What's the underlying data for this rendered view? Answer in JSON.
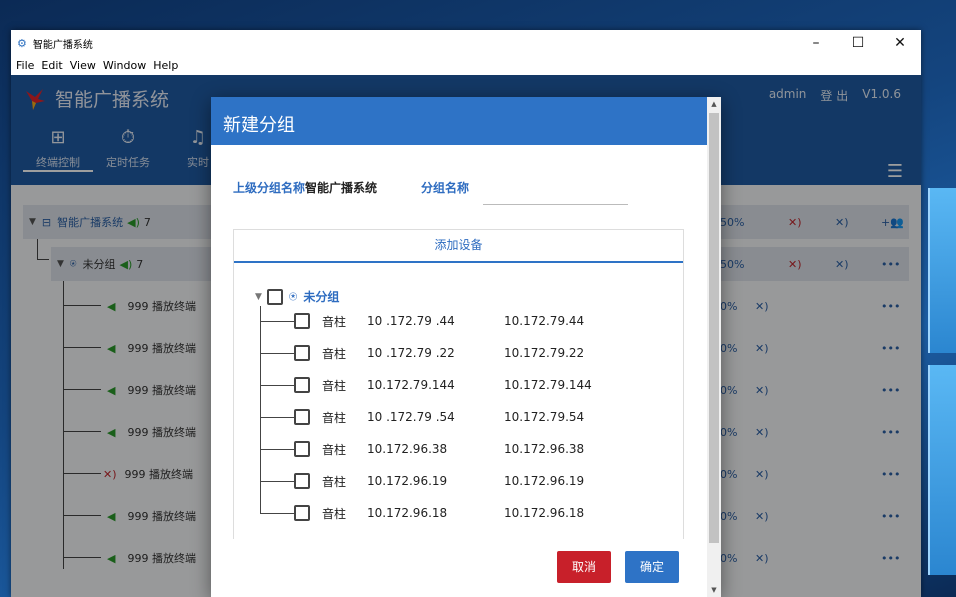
{
  "window": {
    "title": "智能广播系统"
  },
  "menu": [
    "File",
    "Edit",
    "View",
    "Window",
    "Help"
  ],
  "header": {
    "brand": "智能广播系统",
    "nav": [
      {
        "label": "终端控制",
        "icon": "terminal-icon"
      },
      {
        "label": "定时任务",
        "icon": "timer-icon"
      },
      {
        "label": "实时",
        "icon": "music-icon"
      }
    ],
    "user": "admin",
    "logout": "登 出",
    "version": "V1.0.6"
  },
  "tree": {
    "root": {
      "name": "智能广播系统",
      "count": "7",
      "percent": "50%"
    },
    "group": {
      "name": "未分组",
      "count": "7",
      "percent": "50%"
    },
    "terminals": [
      {
        "label": "999 播放终端",
        "muted": false,
        "percent": "0%"
      },
      {
        "label": "999 播放终端",
        "muted": false,
        "percent": "0%"
      },
      {
        "label": "999 播放终端",
        "muted": false,
        "percent": "0%"
      },
      {
        "label": "999 播放终端",
        "muted": false,
        "percent": "0%"
      },
      {
        "label": "999 播放终端",
        "muted": true,
        "percent": "0%"
      },
      {
        "label": "999 播放终端",
        "muted": false,
        "percent": "0%"
      },
      {
        "label": "999 播放终端",
        "muted": false,
        "percent": "0%"
      }
    ]
  },
  "dialog": {
    "title": "新建分组",
    "parent_label": "上级分组名称",
    "parent_value": "智能广播系统",
    "name_label": "分组名称",
    "name_value": "",
    "tab": "添加设备",
    "group_name": "未分组",
    "devices": [
      {
        "type": "音柱",
        "ip_display": "10 .172.79 .44",
        "ip": "10.172.79.44"
      },
      {
        "type": "音柱",
        "ip_display": "10 .172.79 .22",
        "ip": "10.172.79.22"
      },
      {
        "type": "音柱",
        "ip_display": "10.172.79.144",
        "ip": "10.172.79.144"
      },
      {
        "type": "音柱",
        "ip_display": "10 .172.79 .54",
        "ip": "10.172.79.54"
      },
      {
        "type": "音柱",
        "ip_display": "10.172.96.38",
        "ip": "10.172.96.38"
      },
      {
        "type": "音柱",
        "ip_display": "10.172.96.19",
        "ip": "10.172.96.19"
      },
      {
        "type": "音柱",
        "ip_display": "10.172.96.18",
        "ip": "10.172.96.18"
      }
    ],
    "cancel": "取消",
    "confirm": "确定"
  },
  "colors": {
    "primary": "#2e73c6",
    "header": "#1f5ba3",
    "cancel": "#c8202a",
    "speaker_on": "#2b9a2b",
    "speaker_off": "#c0272d"
  }
}
